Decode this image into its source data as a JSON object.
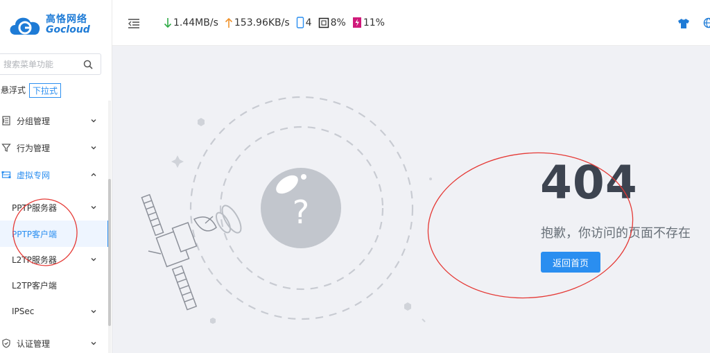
{
  "brand": {
    "name_cn": "高恪网络",
    "name_en": "Gocloud",
    "logo_icon": "gocloud-logo-icon"
  },
  "search": {
    "placeholder": "搜索菜单功能",
    "icon": "search-icon"
  },
  "menu_mode": {
    "float_label": "悬浮式",
    "dropdown_label": "下拉式",
    "selected": "下拉式"
  },
  "sidebar": {
    "items": [
      {
        "label": "分组管理",
        "icon": "group-icon",
        "expanded": false
      },
      {
        "label": "行为管理",
        "icon": "filter-icon",
        "expanded": false
      },
      {
        "label": "虚拟专网",
        "icon": "vpn-icon",
        "expanded": true,
        "children": [
          {
            "label": "PPTP服务器",
            "has_children": true
          },
          {
            "label": "PPTP客户端",
            "selected": true
          },
          {
            "label": "L2TP服务器",
            "has_children": true
          },
          {
            "label": "L2TP客户端"
          },
          {
            "label": "IPSec",
            "has_children": true
          }
        ]
      },
      {
        "label": "认证管理",
        "icon": "shield-icon",
        "expanded": false
      }
    ]
  },
  "topbar": {
    "collapse_icon": "menu-collapse-icon",
    "download": "1.44MB/s",
    "upload": "153.96KB/s",
    "devices": "4",
    "cpu": "8%",
    "memory": "11%",
    "right_icons": [
      "shirt-icon",
      "globe-icon"
    ]
  },
  "error_page": {
    "code": "404",
    "message": "抱歉，你访问的页面不存在",
    "button_label": "返回首页",
    "illustration": "satellite-question-illustration"
  },
  "colors": {
    "accent": "#2a8ef0",
    "download": "#2eaa45",
    "upload": "#f0922b",
    "memory": "#d0197a",
    "background": "#f0f1f5",
    "annotation": "#e53935"
  }
}
